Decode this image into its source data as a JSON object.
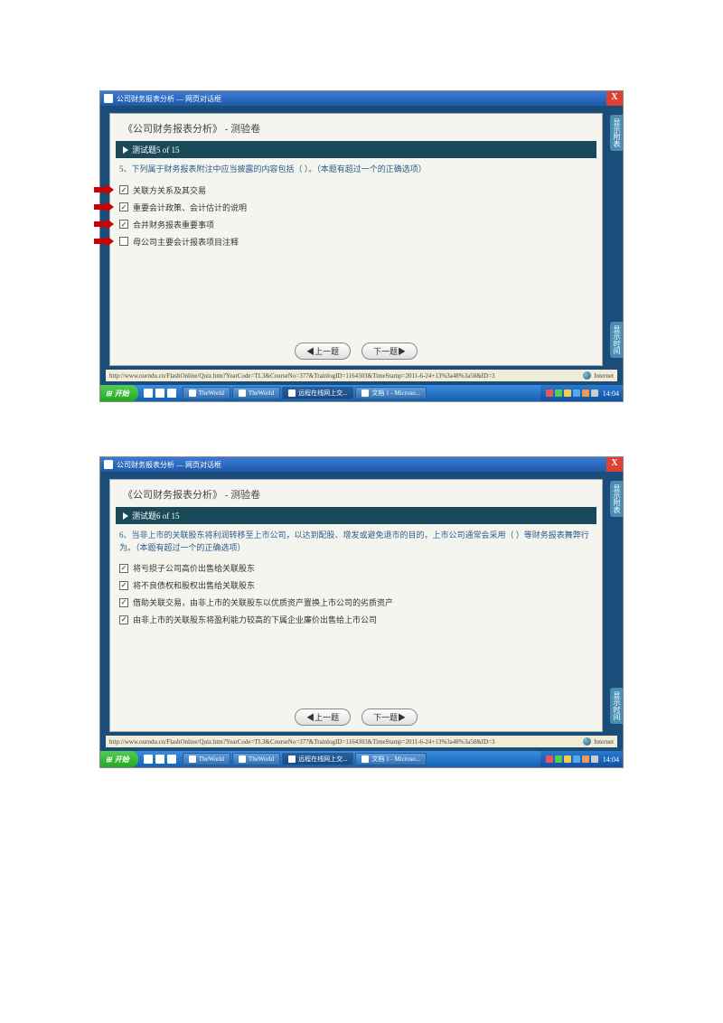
{
  "window": {
    "title": "公司财务报表分析 — 网页对话框",
    "close": "X"
  },
  "app": {
    "side_tab_top": "显示附表",
    "side_tab_bottom": "显示时间"
  },
  "quiz": {
    "title": "《公司财务报表分析》 - 测验卷"
  },
  "nav": {
    "prev": "◀上一题",
    "next": "下一题▶"
  },
  "status": {
    "url": "http://www.ourndu.cn/FlashOnline/Quiz.htm?YearCode=TL3&CourseNo=377&TrainlogID=1164303&TimeStamp=2011-6-24+13%3a48%3a58&ID=3",
    "internet": "Internet"
  },
  "taskbar": {
    "start": "开始",
    "items": [
      {
        "label": "TheWorld",
        "active": false
      },
      {
        "label": "TheWorld",
        "active": false
      },
      {
        "label": "远程在线网上交...",
        "active": true
      },
      {
        "label": "文档 1 - Microso...",
        "active": false
      }
    ],
    "clock": "14:04"
  },
  "q5": {
    "progress": "测试题5 of 15",
    "text": "5、下列属于财务报表附注中应当披露的内容包括（  ）。（本题有超过一个的正确选项）",
    "options": [
      {
        "label": "关联方关系及其交易",
        "checked": true,
        "arrow": true
      },
      {
        "label": "重要会计政策、会计估计的说明",
        "checked": true,
        "arrow": true
      },
      {
        "label": "合并财务报表重要事项",
        "checked": true,
        "arrow": true
      },
      {
        "label": "母公司主要会计报表项目注释",
        "checked": false,
        "arrow": true
      }
    ]
  },
  "q6": {
    "progress": "测试题6 of 15",
    "text": "6、当非上市的关联股东将利润转移至上市公司，以达到配股、增发或避免退市的目的，上市公司通常会采用（  ）等财务报表舞弊行为。（本题有超过一个的正确选项）",
    "options": [
      {
        "label": "将亏损子公司高价出售给关联股东",
        "checked": true,
        "arrow": false
      },
      {
        "label": "将不良债权和股权出售给关联股东",
        "checked": true,
        "arrow": false
      },
      {
        "label": "借助关联交易，由非上市的关联股东以优质资产置换上市公司的劣质资产",
        "checked": true,
        "arrow": false
      },
      {
        "label": "由非上市的关联股东将盈利能力较高的下属企业廉价出售给上市公司",
        "checked": true,
        "arrow": false
      }
    ]
  }
}
